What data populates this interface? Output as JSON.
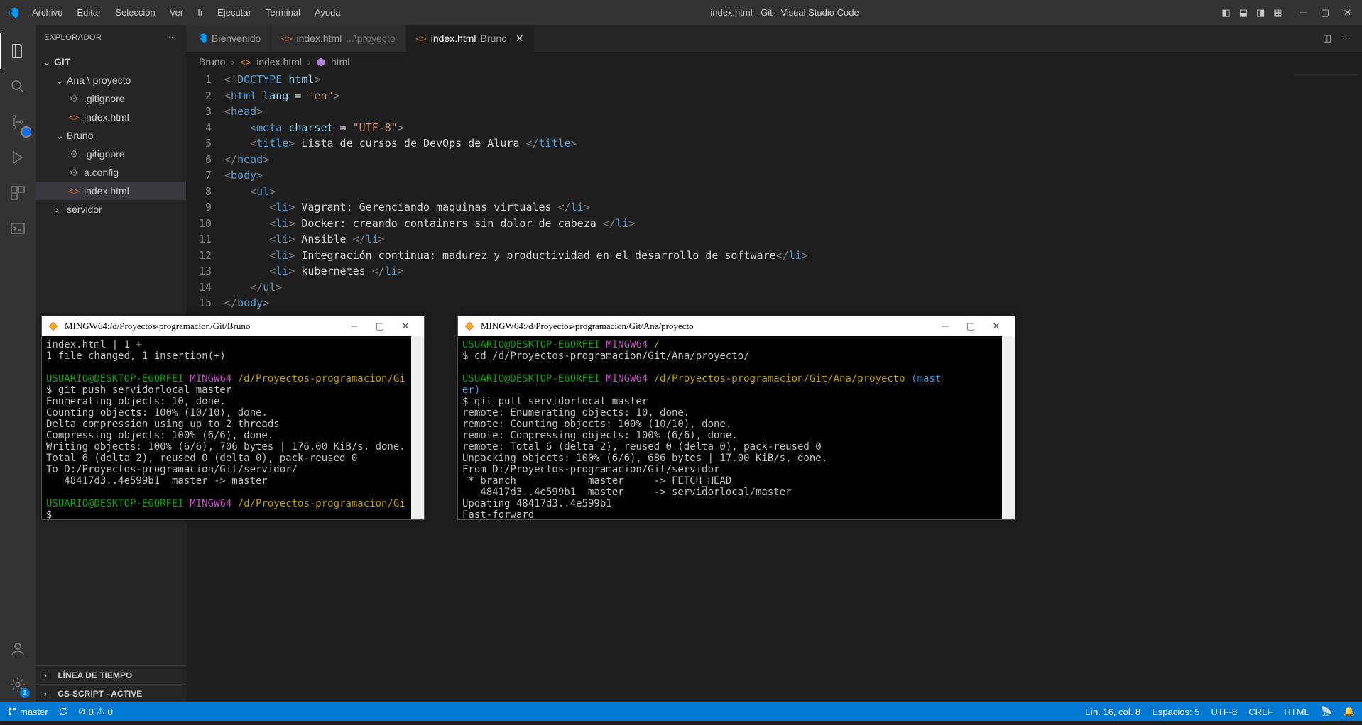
{
  "menu": [
    "Archivo",
    "Editar",
    "Selección",
    "Ver",
    "Ir",
    "Ejecutar",
    "Terminal",
    "Ayuda"
  ],
  "window_title": "index.html - Git - Visual Studio Code",
  "explorer": {
    "title": "EXPLORADOR",
    "root": "GIT",
    "tree": {
      "ana_folder": "Ana \\ proyecto",
      "ana_gitignore": ".gitignore",
      "ana_index": "index.html",
      "bruno_folder": "Bruno",
      "bruno_gitignore": ".gitignore",
      "bruno_aconfig": "a.config",
      "bruno_index": "index.html",
      "servidor": "servidor"
    },
    "timeline": "LÍNEA DE TIEMPO",
    "csscript": "CS-SCRIPT - ACTIVE"
  },
  "tabs": {
    "welcome": "Bienvenido",
    "index_proyecto_name": "index.html",
    "index_proyecto_hint": "...\\proyecto",
    "index_bruno_name": "index.html",
    "index_bruno_hint": "Bruno"
  },
  "breadcrumb": {
    "l1": "Bruno",
    "l2": "index.html",
    "l3": "html"
  },
  "code": {
    "line_numbers": [
      "1",
      "2",
      "3",
      "4",
      "5",
      "6",
      "7",
      "8",
      "9",
      "10",
      "11",
      "12",
      "13",
      "14",
      "15"
    ],
    "title_text": " Lista de cursos de DevOps de Alura ",
    "li1": " Vagrant: Gerenciando maquinas virtuales ",
    "li2": " Docker: creando containers sin dolor de cabeza ",
    "li3": " Ansible ",
    "li4": " Integración continua: madurez y productividad en el desarrollo de software",
    "li5": " kubernetes "
  },
  "terminal1": {
    "title": "MINGW64:/d/Proyectos-programacion/Git/Bruno",
    "lines": [
      {
        "t": "index.html | 1 ",
        "cls": ""
      },
      {
        "t": "+",
        "cls": "t-green",
        "br": true
      },
      {
        "t": "1 file changed, 1 insertion(+)",
        "cls": "",
        "br": true
      },
      {
        "t": "",
        "br": true
      },
      {
        "t": "USUARIO@DESKTOP-E6ORFEI",
        "cls": "t-green"
      },
      {
        "t": " MINGW64 ",
        "cls": "t-mag"
      },
      {
        "t": "/d/Proyectos-programacion/Gi",
        "cls": "t-yel",
        "br": true
      },
      {
        "t": "$ git push servidorlocal master",
        "br": true
      },
      {
        "t": "Enumerating objects: 10, done.",
        "br": true
      },
      {
        "t": "Counting objects: 100% (10/10), done.",
        "br": true
      },
      {
        "t": "Delta compression using up to 2 threads",
        "br": true
      },
      {
        "t": "Compressing objects: 100% (6/6), done.",
        "br": true
      },
      {
        "t": "Writing objects: 100% (6/6), 706 bytes | 176.00 KiB/s, done.",
        "br": true
      },
      {
        "t": "Total 6 (delta 2), reused 0 (delta 0), pack-reused 0",
        "br": true
      },
      {
        "t": "To D:/Proyectos-programacion/Git/servidor/",
        "br": true
      },
      {
        "t": "   48417d3..4e599b1  master -> master",
        "br": true
      },
      {
        "t": "",
        "br": true
      },
      {
        "t": "USUARIO@DESKTOP-E6ORFEI",
        "cls": "t-green"
      },
      {
        "t": " MINGW64 ",
        "cls": "t-mag"
      },
      {
        "t": "/d/Proyectos-programacion/Gi",
        "cls": "t-yel",
        "br": true
      },
      {
        "t": "$ ",
        "br": false
      }
    ]
  },
  "terminal2": {
    "title": "MINGW64:/d/Proyectos-programacion/Git/Ana/proyecto",
    "lines": [
      {
        "t": "USUARIO@DESKTOP-E6ORFEI",
        "cls": "t-green"
      },
      {
        "t": " MINGW64 ",
        "cls": "t-mag"
      },
      {
        "t": "/",
        "cls": "t-yel",
        "br": true
      },
      {
        "t": "$ cd /d/Proyectos-programacion/Git/Ana/proyecto/",
        "br": true
      },
      {
        "t": "",
        "br": true
      },
      {
        "t": "USUARIO@DESKTOP-E6ORFEI",
        "cls": "t-green"
      },
      {
        "t": " MINGW64 ",
        "cls": "t-mag"
      },
      {
        "t": "/d/Proyectos-programacion/Git/Ana/proyecto",
        "cls": "t-yel"
      },
      {
        "t": " (mast",
        "cls": "t-cyan",
        "br": true
      },
      {
        "t": "er)",
        "cls": "t-cyan",
        "br": true
      },
      {
        "t": "$ git pull servidorlocal master",
        "br": true
      },
      {
        "t": "remote: Enumerating objects: 10, done.",
        "br": true
      },
      {
        "t": "remote: Counting objects: 100% (10/10), done.",
        "br": true
      },
      {
        "t": "remote: Compressing objects: 100% (6/6), done.",
        "br": true
      },
      {
        "t": "remote: Total 6 (delta 2), reused 0 (delta 0), pack-reused 0",
        "br": true
      },
      {
        "t": "Unpacking objects: 100% (6/6), 686 bytes | 17.00 KiB/s, done.",
        "br": true
      },
      {
        "t": "From D:/Proyectos-programacion/Git/servidor",
        "br": true
      },
      {
        "t": " * branch            master     -> FETCH_HEAD",
        "br": true
      },
      {
        "t": "   48417d3..4e599b1  master     -> servidorlocal/master",
        "br": true
      },
      {
        "t": "Updating 48417d3..4e599b1",
        "br": true
      },
      {
        "t": "Fast-forward",
        "br": true
      }
    ]
  },
  "status": {
    "branch": "master",
    "errors": "0",
    "warnings": "0",
    "position": "Lín. 16, col. 8",
    "spaces": "Espacios: 5",
    "encoding": "UTF-8",
    "eol": "CRLF",
    "lang": "HTML"
  },
  "badge_scm": "1"
}
